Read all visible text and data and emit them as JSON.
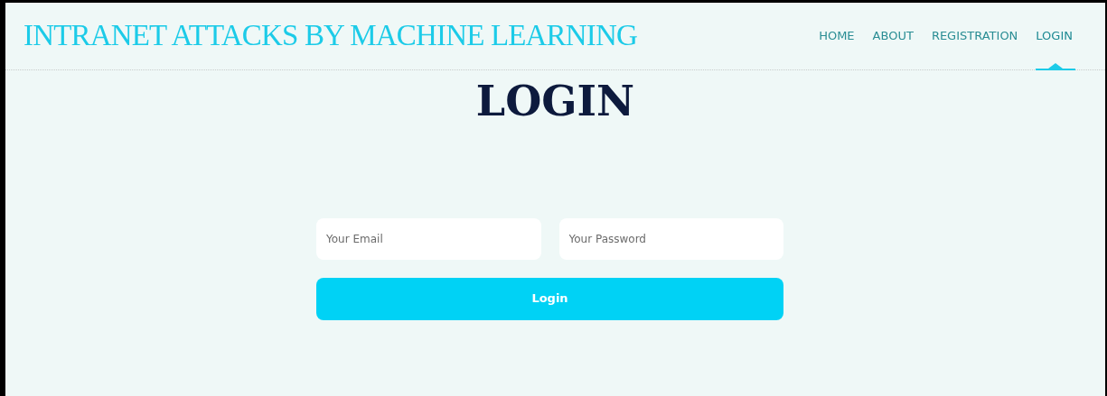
{
  "site_title": "INTRANET ATTACKS BY MACHINE LEARNING",
  "nav": [
    {
      "label": "HOME",
      "selected": false
    },
    {
      "label": "ABOUT",
      "selected": false
    },
    {
      "label": "REGISTRATION",
      "selected": false
    },
    {
      "label": "LOGIN",
      "selected": true
    }
  ],
  "heading": "LOGIN",
  "form": {
    "fields": [
      {
        "placeholder": "Your Email"
      },
      {
        "placeholder": "Your Password"
      }
    ],
    "button": "Login"
  }
}
